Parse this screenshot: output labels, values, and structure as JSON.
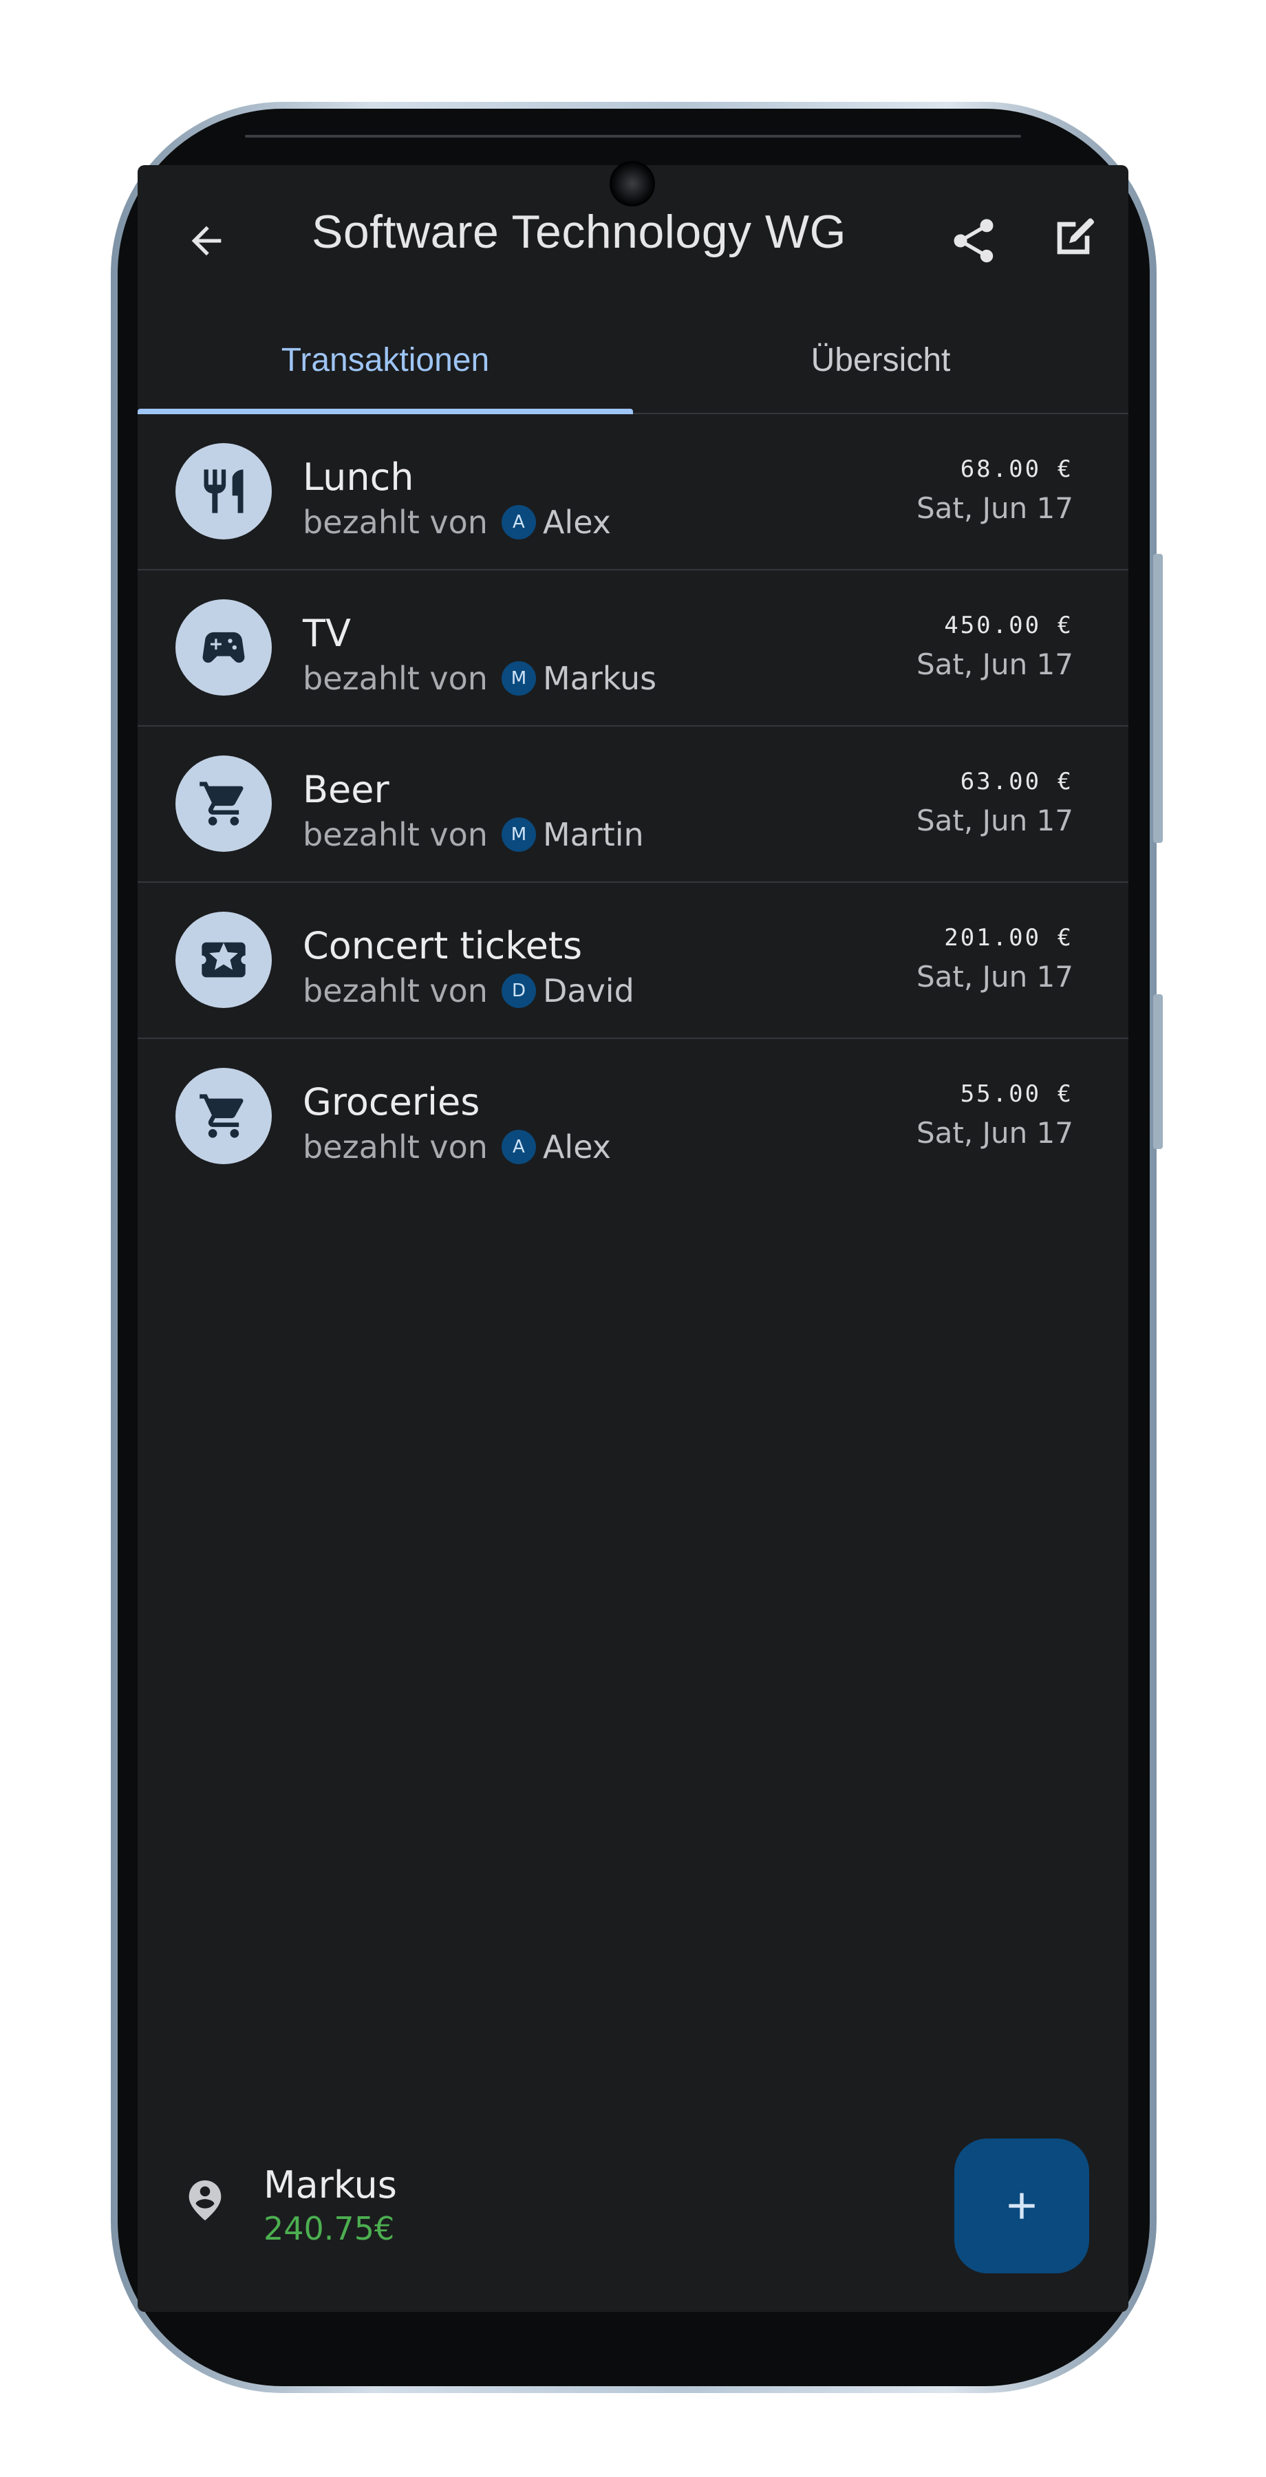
{
  "appbar": {
    "title": "Software Technology WG",
    "back_icon": "arrow-back-icon",
    "share_icon": "share-icon",
    "edit_icon": "edit-icon"
  },
  "tabs": [
    {
      "label": "Transaktionen",
      "selected": true
    },
    {
      "label": "Übersicht",
      "selected": false
    }
  ],
  "transactions": [
    {
      "title": "Lunch",
      "paid_by_label": "bezahlt von",
      "payer_initial": "A",
      "payer": "Alex",
      "amount": "68.00 €",
      "date": "Sat, Jun 17",
      "icon": "restaurant-icon"
    },
    {
      "title": "TV",
      "paid_by_label": "bezahlt von",
      "payer_initial": "M",
      "payer": "Markus",
      "amount": "450.00 €",
      "date": "Sat, Jun 17",
      "icon": "gamepad-icon"
    },
    {
      "title": "Beer",
      "paid_by_label": "bezahlt von",
      "payer_initial": "M",
      "payer": "Martin",
      "amount": "63.00 €",
      "date": "Sat, Jun 17",
      "icon": "shopping-cart-icon"
    },
    {
      "title": "Concert tickets",
      "paid_by_label": "bezahlt von",
      "payer_initial": "D",
      "payer": "David",
      "amount": "201.00 €",
      "date": "Sat, Jun 17",
      "icon": "ticket-icon"
    },
    {
      "title": "Groceries",
      "paid_by_label": "bezahlt von",
      "payer_initial": "A",
      "payer": "Alex",
      "amount": "55.00 €",
      "date": "Sat, Jun 17",
      "icon": "shopping-cart-icon"
    }
  ],
  "user": {
    "name": "Markus",
    "balance": "240.75€",
    "icon": "person-pin-icon"
  },
  "fab": {
    "icon": "add-icon"
  },
  "colors": {
    "background": "#1b1c1e",
    "accent": "#9ec5f5",
    "icon_circle": "#c2d2e6",
    "fab": "#0a4a7e",
    "positive_balance": "#4caf50"
  }
}
